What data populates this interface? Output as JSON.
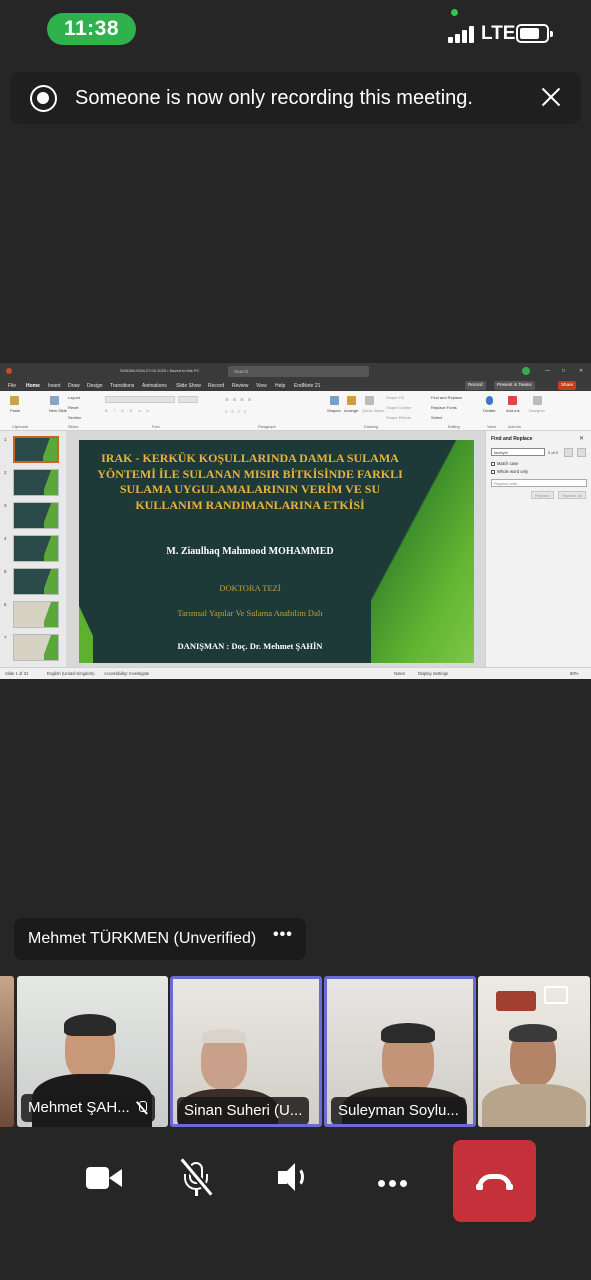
{
  "status_bar": {
    "time": "11:38",
    "network": "LTE",
    "battery_percent": 75
  },
  "notification": {
    "text": "Someone is now only recording this meeting."
  },
  "shared_screen": {
    "app_title": "SUNUM-SON-27.02.2023 • Saved to this PC",
    "search_placeholder": "Search",
    "menu": [
      "File",
      "Home",
      "Insert",
      "Draw",
      "Design",
      "Transitions",
      "Animations",
      "Slide Show",
      "Record",
      "Review",
      "View",
      "Help",
      "EndNote 21"
    ],
    "active_menu": "Home",
    "record_btn": "Record",
    "present_btn": "Present in Teams",
    "share_btn": "Share",
    "ribbon_groups": [
      "Clipboard",
      "Slides",
      "Font",
      "Paragraph",
      "Drawing",
      "Editing",
      "Voice",
      "Add-ins"
    ],
    "ribbon_items": {
      "paste": "Paste",
      "new_slide": "New Slide",
      "layout": "Layout",
      "reset": "Reset",
      "section": "Section",
      "shapes": "Shapes",
      "arrange": "Arrange",
      "quick_styles": "Quick Styles",
      "shape_fill": "Shape Fill",
      "shape_outline": "Shape Outline",
      "shape_effects": "Shape Effects",
      "find_replace": "Find and Replace",
      "replace_fonts": "Replace Fonts",
      "select": "Select",
      "dictate": "Dictate",
      "add_ins": "Add-ins",
      "designer": "Designer"
    },
    "slide": {
      "title": "IRAK - KERKÜK KOŞULLARINDA DAMLA SULAMA YÖNTEMİ İLE SULANAN MISIR BİTKİSİNDE FARKLI SULAMA UYGULAMALARININ VERİM VE SU KULLANIM RANDIMANLARINA ETKİSİ",
      "author": "M. Ziaulhaq Mahmood MOHAMMED",
      "degree": "DOKTORA TEZİ",
      "department": "Tarımsal Yapılar Ve Sulama Anabilim Dalı",
      "advisor": "DANIŞMAN : Doç. Dr. Mehmet ŞAHİN"
    },
    "thumbnails": [
      "1",
      "2",
      "3",
      "4",
      "5",
      "6",
      "7"
    ],
    "find_pane": {
      "title": "Find and Replace",
      "search_value": "fazetyel",
      "count": "0 of 0",
      "match_case": "Match case",
      "whole_word": "Whole word only",
      "replace_placeholder": "Replace with...",
      "replace_btn": "Replace",
      "replace_all_btn": "Replace All"
    },
    "status": {
      "slide": "Slide 1 of 31",
      "language": "English (United Kingdom)",
      "accessibility": "Accessibility: Investigate",
      "notes": "Notes",
      "display_settings": "Display Settings",
      "zoom": "80%"
    }
  },
  "speaker_tag": {
    "name": "Mehmet TÜRKMEN (Unverified)",
    "more": "•••"
  },
  "participants": [
    {
      "name": "Mehmet ŞAH...",
      "muted": true,
      "active": false
    },
    {
      "name": "Sinan Suheri (U...",
      "muted": false,
      "active": true
    },
    {
      "name": "Suleyman Soylu...",
      "muted": false,
      "active": true
    },
    {
      "name": "",
      "muted": false,
      "active": false
    }
  ],
  "controls": {
    "camera": "camera-icon",
    "mic": "mic-off-icon",
    "speaker": "speaker-icon",
    "more": "more-icon",
    "hangup": "hangup-icon",
    "hangup_color": "#c4313a"
  }
}
